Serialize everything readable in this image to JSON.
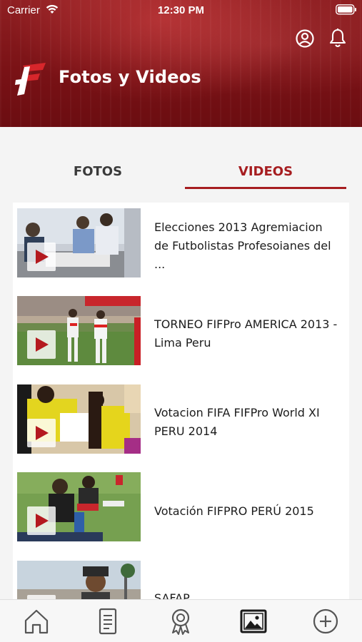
{
  "status_bar": {
    "carrier": "Carrier",
    "time": "12:30 PM"
  },
  "header": {
    "title": "Fotos y Videos",
    "icons": [
      "user-circle-icon",
      "bell-icon"
    ],
    "accent": "#7a1216"
  },
  "tabs": {
    "items": [
      {
        "label": "FOTOS",
        "active": false
      },
      {
        "label": "VIDEOS",
        "active": true
      }
    ],
    "active_color": "#a61d20"
  },
  "videos": [
    {
      "title": "Elecciones 2013 Agremiacion de Futbolistas Profesoianes del ..."
    },
    {
      "title": "TORNEO FIFPro AMERICA 2013 - Lima Peru"
    },
    {
      "title": "Votacion FIFA FIFPro World XI PERU 2014"
    },
    {
      "title": "Votación FIFPRO PERÚ 2015"
    },
    {
      "title": "SAFAP"
    }
  ],
  "tabbar": {
    "items": [
      {
        "icon": "home-icon",
        "active": false
      },
      {
        "icon": "document-icon",
        "active": false
      },
      {
        "icon": "award-icon",
        "active": false
      },
      {
        "icon": "gallery-icon",
        "active": true
      },
      {
        "icon": "plus-circle-icon",
        "active": false
      }
    ]
  }
}
